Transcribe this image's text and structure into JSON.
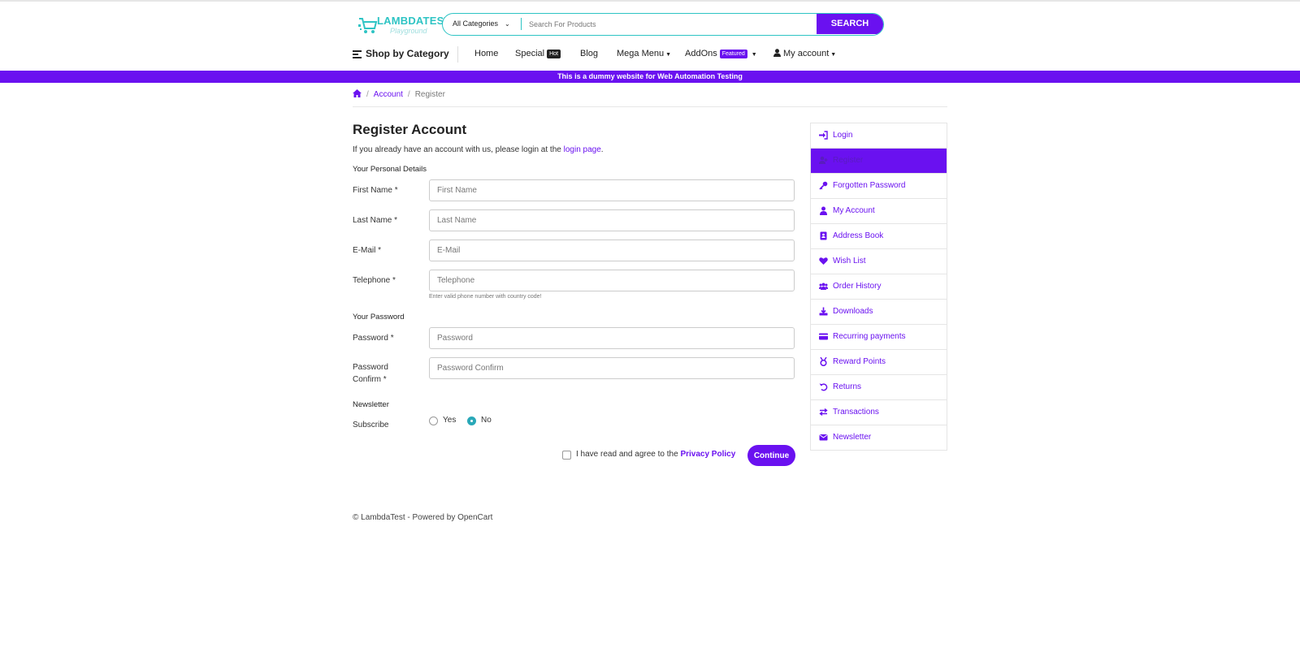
{
  "header": {
    "logo_title": "LAMBDATEST",
    "logo_subtitle": "Playground",
    "search": {
      "category": "All Categories",
      "placeholder": "Search For Products",
      "button_label": "SEARCH"
    }
  },
  "nav": {
    "shop_by_category": "Shop by Category",
    "home": "Home",
    "special": "Special",
    "special_badge": "Hot",
    "blog": "Blog",
    "mega_menu": "Mega Menu",
    "addons": "AddOns",
    "addons_badge": "Featured",
    "my_account": "My account"
  },
  "banner": "This is a dummy website for Web Automation Testing",
  "breadcrumb": {
    "account": "Account",
    "current": "Register"
  },
  "form": {
    "title": "Register Account",
    "intro_text": "If you already have an account with us, please login at the",
    "intro_link": "login page",
    "intro_end": ".",
    "personal_section": "Your Personal Details",
    "fields": {
      "first_name": {
        "label": "First Name",
        "placeholder": "First Name"
      },
      "last_name": {
        "label": "Last Name",
        "placeholder": "Last Name"
      },
      "email": {
        "label": "E-Mail",
        "placeholder": "E-Mail"
      },
      "telephone": {
        "label": "Telephone",
        "placeholder": "Telephone",
        "help": "Enter valid phone number with country code!"
      },
      "password": {
        "label": "Password",
        "placeholder": "Password"
      },
      "password_confirm": {
        "label_line1": "Password",
        "label_line2": "Confirm",
        "placeholder": "Password Confirm"
      }
    },
    "required_mark": "*",
    "password_section": "Your Password",
    "newsletter_section": "Newsletter",
    "subscribe_label": "Subscribe",
    "subscribe_options": [
      "Yes",
      "No"
    ],
    "subscribe_selected": "No",
    "agree_text": "I have read and agree to the",
    "privacy_link": "Privacy Policy",
    "continue_label": "Continue"
  },
  "sidebar": {
    "items": [
      {
        "label": "Login",
        "icon": "sign-in-icon"
      },
      {
        "label": "Register",
        "icon": "user-plus-icon",
        "active": true
      },
      {
        "label": "Forgotten Password",
        "icon": "key-icon"
      },
      {
        "label": "My Account",
        "icon": "user-icon"
      },
      {
        "label": "Address Book",
        "icon": "address-book-icon"
      },
      {
        "label": "Wish List",
        "icon": "heart-icon"
      },
      {
        "label": "Order History",
        "icon": "users-icon"
      },
      {
        "label": "Downloads",
        "icon": "download-icon"
      },
      {
        "label": "Recurring payments",
        "icon": "credit-card-icon"
      },
      {
        "label": "Reward Points",
        "icon": "medal-icon"
      },
      {
        "label": "Returns",
        "icon": "undo-icon"
      },
      {
        "label": "Transactions",
        "icon": "exchange-icon"
      },
      {
        "label": "Newsletter",
        "icon": "envelope-icon"
      }
    ]
  },
  "footer": "© LambdaTest - Powered by OpenCart",
  "colors": {
    "brand": "#6a11f0",
    "accent_teal": "#2ec4c4"
  }
}
